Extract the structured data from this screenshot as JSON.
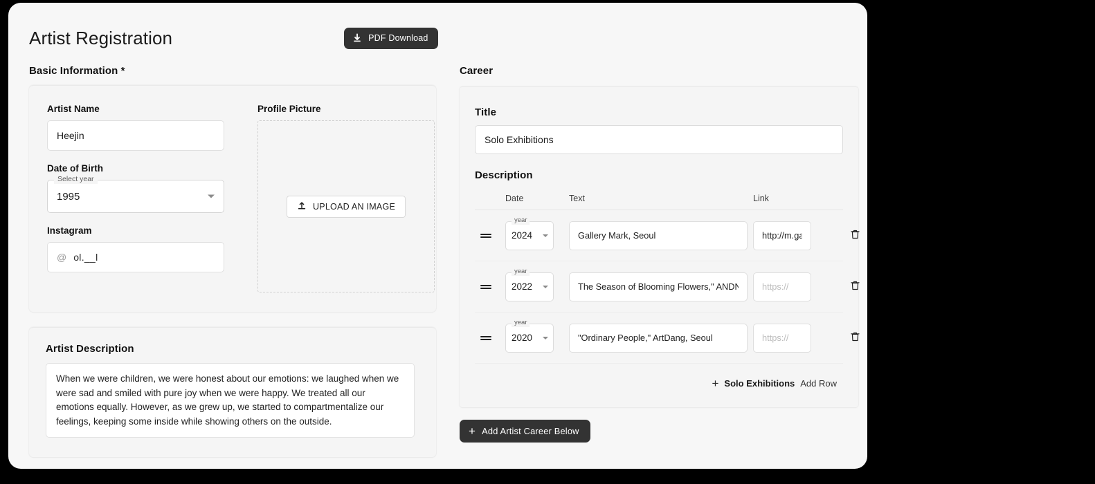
{
  "header": {
    "title": "Artist Registration",
    "pdf_button": "PDF Download",
    "pdf_icon": "download-icon"
  },
  "basic": {
    "section_label": "Basic Information *",
    "artist_name": {
      "label": "Artist Name",
      "value": "Heejin",
      "placeholder": ""
    },
    "date_of_birth": {
      "label": "Date of Birth",
      "legend": "Select year",
      "value": "1995",
      "caret_icon": "chevron-down-icon"
    },
    "instagram": {
      "label": "Instagram",
      "prefix": "@",
      "value": "ol.__l"
    },
    "profile_picture": {
      "label": "Profile Picture",
      "upload_button": "UPLOAD AN IMAGE",
      "upload_icon": "upload-icon"
    }
  },
  "description": {
    "label": "Artist Description",
    "value": "When we were children, we were honest about our emotions: we laughed when we were sad and smiled with pure joy when we were happy. We treated all our emotions equally. However, as we grew up, we started to compartmentalize our feelings, keeping some inside while showing others on the outside."
  },
  "career": {
    "section_label": "Career",
    "title_label": "Title",
    "title_value": "Solo Exhibitions",
    "description_label": "Description",
    "columns": {
      "drag": "",
      "date": "Date",
      "text": "Text",
      "link": "Link"
    },
    "year_legend": "year",
    "rows": [
      {
        "drag_icon": "drag-handle-icon",
        "year": "2024",
        "text": "Gallery Mark, Seoul",
        "link": "http://m.gall",
        "link_placeholder": "https://",
        "delete_icon": "trash-icon"
      },
      {
        "drag_icon": "drag-handle-icon",
        "year": "2022",
        "text": "The Season of Blooming Flowers,\" ANDNEW G",
        "link": "",
        "link_placeholder": "https://",
        "delete_icon": "trash-icon"
      },
      {
        "drag_icon": "drag-handle-icon",
        "year": "2020",
        "text": "\"Ordinary People,\" ArtDang, Seoul",
        "link": "",
        "link_placeholder": "https://",
        "delete_icon": "trash-icon"
      }
    ],
    "add_row": {
      "plus": "+",
      "strong": "Solo Exhibitions",
      "light": "Add Row"
    },
    "add_career": {
      "plus": "+",
      "label": "Add Artist Career Below"
    }
  },
  "colors": {
    "page_background": "#000000",
    "card_background": "#f7f7f7",
    "panel_background": "#f5f5f5",
    "input_background": "#ffffff",
    "dark_button": "#333333",
    "text_primary": "#111111",
    "text_muted": "#5a5a5a",
    "placeholder": "#bcbcbc"
  }
}
